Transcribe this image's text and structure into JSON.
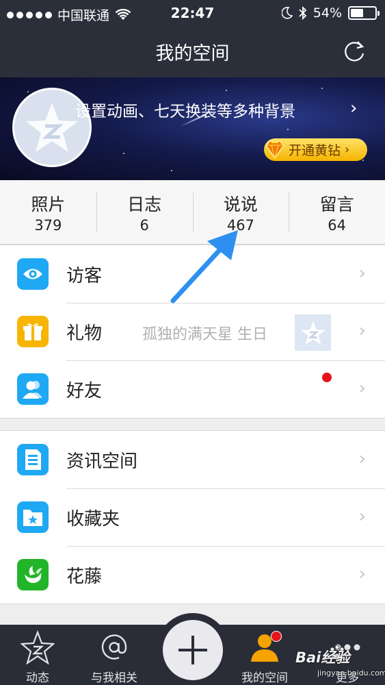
{
  "status_bar": {
    "carrier": "中国联通",
    "time": "22:47",
    "battery_percent": "54%",
    "battery_level": 0.54
  },
  "nav": {
    "title": "我的空间",
    "refresh_icon": "refresh-icon"
  },
  "banner": {
    "text": "设置动画、七天换装等多种背景",
    "chevron": "›",
    "vip_button_label": "开通黄钻",
    "vip_chevron": "›"
  },
  "stats": [
    {
      "label": "照片",
      "value": "379"
    },
    {
      "label": "日志",
      "value": "6"
    },
    {
      "label": "说说",
      "value": "467"
    },
    {
      "label": "留言",
      "value": "64"
    }
  ],
  "menu_group_1": [
    {
      "label": "访客",
      "icon": "eye-icon",
      "color": "#1fa8f3"
    },
    {
      "label": "礼物",
      "icon": "gift-icon",
      "color": "#f7b500",
      "hint": "孤独的满天星 生日"
    },
    {
      "label": "好友",
      "icon": "friends-icon",
      "color": "#1fa8f3"
    }
  ],
  "menu_group_2": [
    {
      "label": "资讯空间",
      "icon": "news-icon",
      "color": "#1fa8f3"
    },
    {
      "label": "收藏夹",
      "icon": "favorites-folder-icon",
      "color": "#1fa8f3"
    },
    {
      "label": "花藤",
      "icon": "huateng-icon",
      "color": "#22b52a"
    }
  ],
  "row_chevron": "›",
  "tabbar": {
    "tabs": [
      {
        "label": "动态",
        "icon": "qzone-star-icon"
      },
      {
        "label": "与我相关",
        "icon": "at-icon"
      },
      {
        "label": "我的空间",
        "icon": "user-icon"
      },
      {
        "label": "更多",
        "icon": "more-dots-icon"
      }
    ],
    "add_button_icon": "plus-icon"
  },
  "watermark": {
    "brand": "Bai经验",
    "url": "jingyan.baidu.com"
  },
  "colors": {
    "nav_bg": "#2b2f3a",
    "vip_gold": "#f5b400",
    "annotation_arrow": "#2f8ff0",
    "badge_red": "#e5141a"
  }
}
